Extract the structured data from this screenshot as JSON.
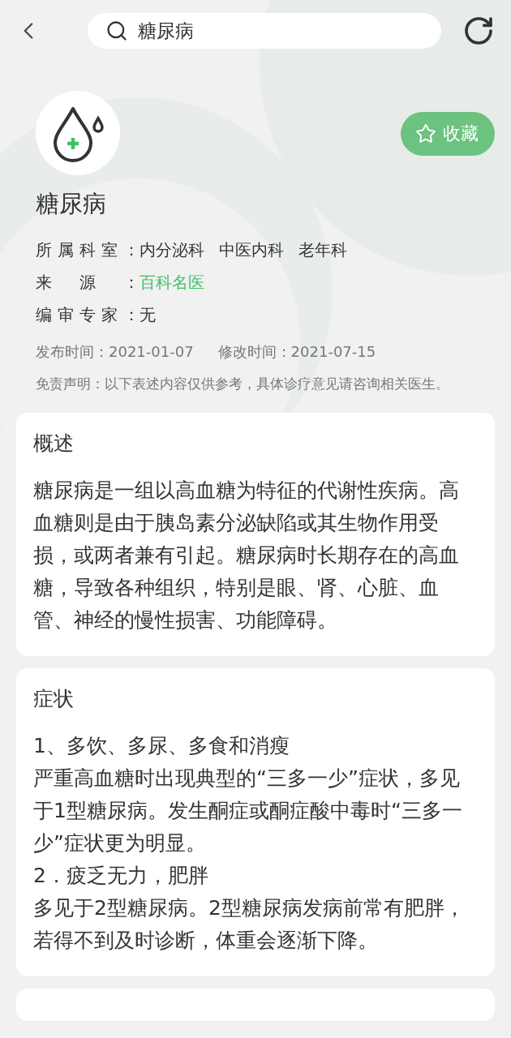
{
  "header": {
    "search": {
      "value": "糖尿病"
    }
  },
  "disease": {
    "title": "糖尿病",
    "favorite": {
      "label": "收藏",
      "selected": false
    },
    "meta": [
      {
        "label": "所属科室：",
        "values": [
          {
            "text": "内分泌科",
            "kind": "plain"
          },
          {
            "text": "中医内科",
            "kind": "plain"
          },
          {
            "text": "老年科",
            "kind": "plain"
          }
        ]
      },
      {
        "label": "来源：",
        "values": [
          {
            "text": "百科名医",
            "kind": "link"
          }
        ]
      },
      {
        "label": "编审专家：",
        "values": [
          {
            "text": "无",
            "kind": "plain"
          }
        ]
      }
    ],
    "dates": [
      {
        "label": "发布时间：",
        "value": "2021-01-07"
      },
      {
        "label": "修改时间：",
        "value": "2021-07-15"
      }
    ],
    "disclaimer": "免责声明：以下表述内容仅供参考，具体诊疗意见请咨询相关医生。"
  },
  "sections": [
    {
      "title": "概述",
      "paragraphs": [
        "糖尿病是一组以高血糖为特征的代谢性疾病。高血糖则是由于胰岛素分泌缺陷或其生物作用受损，或两者兼有引起。糖尿病时长期存在的高血糖，导致各种组织，特别是眼、肾、心脏、血管、神经的慢性损害、功能障碍。"
      ]
    },
    {
      "title": "症状",
      "paragraphs": [
        "1、多饮、多尿、多食和消瘦",
        "严重高血糖时出现典型的“三多一少”症状，多见于1型糖尿病。发生酮症或酮症酸中毒时“三多一少”症状更为明显。",
        "2．疲乏无力，肥胖",
        "多见于2型糖尿病。2型糖尿病发病前常有肥胖，若得不到及时诊断，体重会逐渐下降。"
      ]
    }
  ]
}
